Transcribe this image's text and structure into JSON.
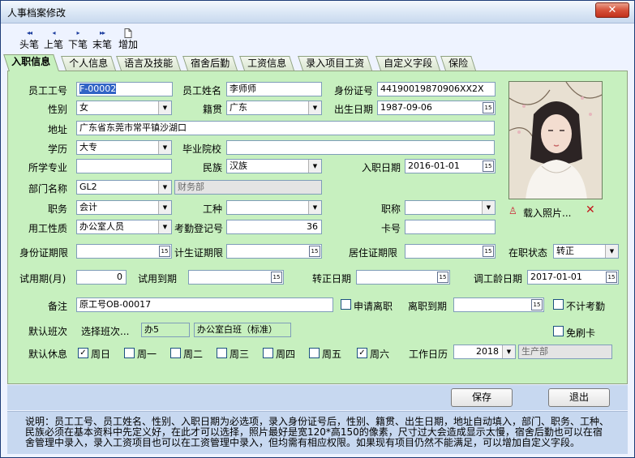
{
  "window": {
    "title": "人事档案修改",
    "close_glyph": "✕"
  },
  "toolbar": {
    "first": "头笔",
    "prev": "上笔",
    "next": "下笔",
    "last": "末笔",
    "add": "增加",
    "first_arrow": "◂◂",
    "prev_arrow": "◂",
    "next_arrow": "▸",
    "last_arrow": "▸▸"
  },
  "tabs": [
    "入职信息",
    "个人信息",
    "语言及技能",
    "宿舍后勤",
    "工资信息",
    "录入项目工资",
    "自定义字段",
    "保险"
  ],
  "form": {
    "emp_no": {
      "label": "员工工号",
      "value": "F-00002"
    },
    "emp_name": {
      "label": "员工姓名",
      "value": "李师师"
    },
    "id_no": {
      "label": "身份证号",
      "value": "44190019870906XX2X"
    },
    "gender": {
      "label": "性别",
      "value": "女"
    },
    "native": {
      "label": "籍贯",
      "value": "广东"
    },
    "birth": {
      "label": "出生日期",
      "value": "1987-09-06"
    },
    "address": {
      "label": "地址",
      "value": "广东省东莞市常平镇沙湖口"
    },
    "education": {
      "label": "学历",
      "value": "大专"
    },
    "school": {
      "label": "毕业院校",
      "value": ""
    },
    "major": {
      "label": "所学专业",
      "value": ""
    },
    "ethnic": {
      "label": "民族",
      "value": "汉族"
    },
    "hire_date": {
      "label": "入职日期",
      "value": "2016-01-01"
    },
    "dept_code": {
      "label": "部门名称",
      "value": "GL2"
    },
    "dept_name": {
      "value": "财务部"
    },
    "position": {
      "label": "职务",
      "value": "会计"
    },
    "work_type": {
      "label": "工种",
      "value": ""
    },
    "title": {
      "label": "职称",
      "value": ""
    },
    "emp_nature": {
      "label": "用工性质",
      "value": "办公室人员"
    },
    "attend_no": {
      "label": "考勤登记号",
      "value": "36"
    },
    "card_no": {
      "label": "卡号",
      "value": ""
    },
    "id_expiry": {
      "label": "身份证期限",
      "value": ""
    },
    "family_plan": {
      "label": "计生证期限",
      "value": ""
    },
    "residence": {
      "label": "居住证期限",
      "value": ""
    },
    "status": {
      "label": "在职状态",
      "value": "转正"
    },
    "probation_months": {
      "label": "试用期(月)",
      "value": "0"
    },
    "probation_end": {
      "label": "试用到期",
      "value": ""
    },
    "confirm_date": {
      "label": "转正日期",
      "value": ""
    },
    "seniority_date": {
      "label": "调工龄日期",
      "value": "2017-01-01"
    },
    "remark": {
      "label": "备注",
      "value": "原工号OB-00017"
    },
    "apply_leave": {
      "label": "申请离职",
      "checked": false
    },
    "leave_due": {
      "label": "离职到期",
      "value": ""
    },
    "no_attend": {
      "label": "不计考勤",
      "checked": false
    },
    "default_shift": {
      "label": "默认班次",
      "select_label": "选择班次...",
      "code": "办5",
      "name": "办公室白班（标准）"
    },
    "no_swipe": {
      "label": "免刷卡",
      "checked": false
    },
    "default_rest": {
      "label": "默认休息"
    },
    "days": [
      {
        "label": "周日",
        "checked": true
      },
      {
        "label": "周一",
        "checked": false
      },
      {
        "label": "周二",
        "checked": false
      },
      {
        "label": "周三",
        "checked": false
      },
      {
        "label": "周四",
        "checked": false
      },
      {
        "label": "周五",
        "checked": false
      },
      {
        "label": "周六",
        "checked": true
      }
    ],
    "calendar": {
      "label": "工作日历",
      "year": "2018",
      "dept": "生产部"
    }
  },
  "photo": {
    "load_label": "载入照片...",
    "delete_glyph": "✕",
    "user_glyph": "♙"
  },
  "buttons": {
    "save": "保存",
    "exit": "退出"
  },
  "note": "说明：员工工号、员工姓名、性别、入职日期为必选项，录入身份证号后，性别、籍贯、出生日期，地址自动填入，部门、职务、工种、民族必须在基本资料中先定义好，在此才可以选择，照片最好是宽120*高150的像素，尺寸过大会造成显示太慢，宿舍后勤也可以在宿舍管理中录入，录入工资项目也可以在工资管理中录入，但均需有相应权限。如果现有项目仍然不能满足，可以增加自定义字段。"
}
